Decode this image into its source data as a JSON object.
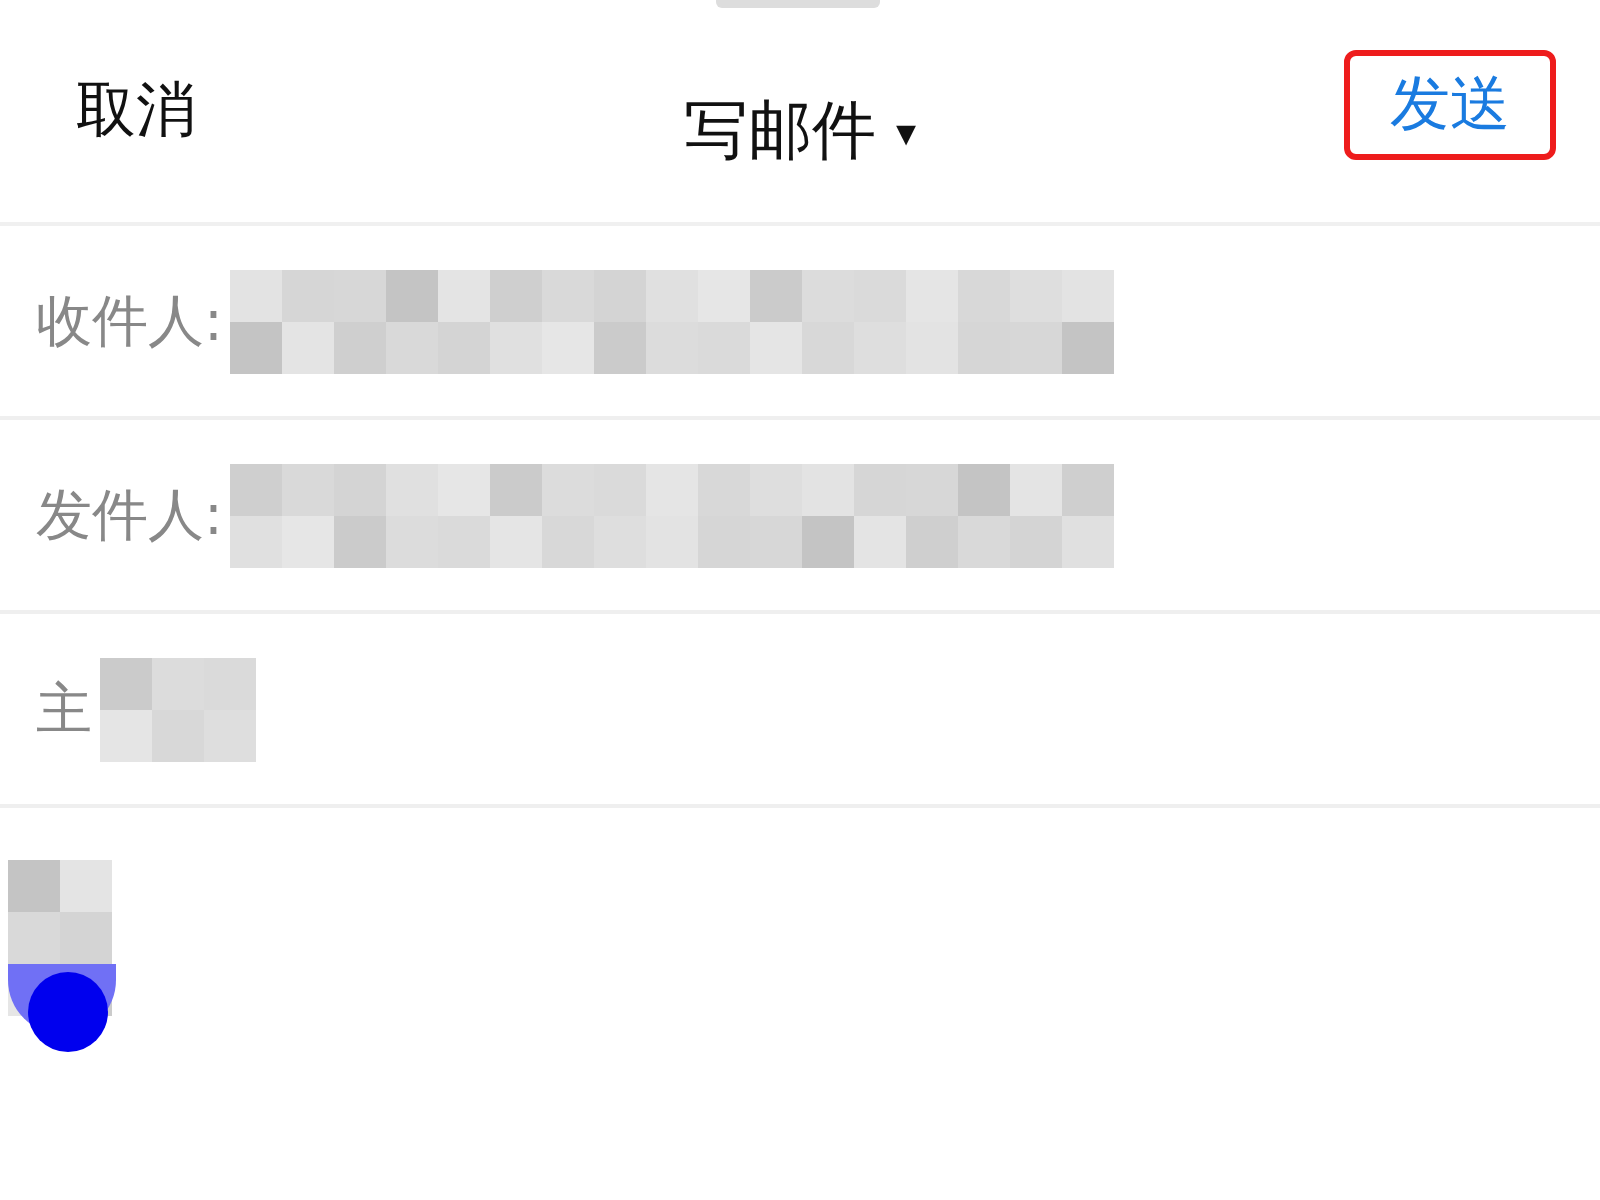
{
  "header": {
    "cancel": "取消",
    "title": "写邮件",
    "title_caret": "▾",
    "send": {
      "label": "发送",
      "highlighted": true
    }
  },
  "fields": [
    {
      "label": "收件人:",
      "redacted": true
    },
    {
      "label": "发件人:",
      "redacted": true
    },
    {
      "label": "主",
      "redacted": true
    }
  ],
  "body": {
    "redacted": true
  }
}
